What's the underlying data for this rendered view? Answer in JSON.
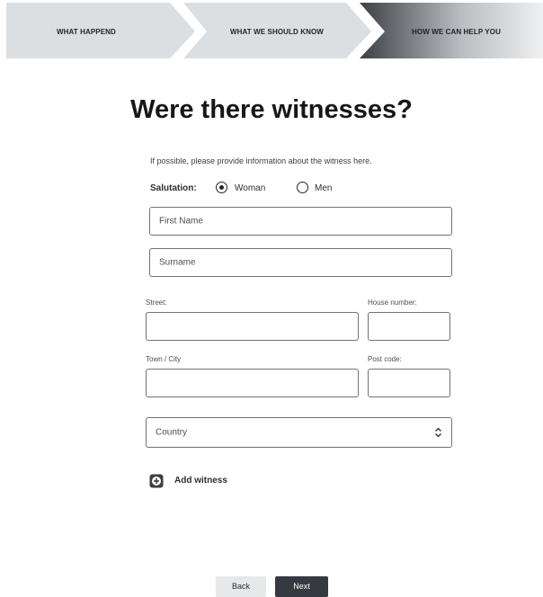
{
  "stepper": {
    "steps": [
      {
        "label": "WHAT HAPPEND"
      },
      {
        "label": "WHAT WE SHOULD KNOW"
      },
      {
        "label": "HOW WE CAN HELP YOU"
      }
    ],
    "active_index": 2,
    "colors": {
      "inactive": "#dcdfe1",
      "active_start": "#3b4045",
      "active_end": "#eef0f1"
    }
  },
  "page": {
    "title": "Were there witnesses?",
    "intro": "If possible, please provide information about the witness here."
  },
  "salutation": {
    "label": "Salutation:",
    "options": [
      {
        "label": "Woman",
        "selected": true
      },
      {
        "label": "Men",
        "selected": false
      }
    ]
  },
  "fields": {
    "first_name": {
      "placeholder": "First Name",
      "value": ""
    },
    "surname": {
      "placeholder": "Surname",
      "value": ""
    },
    "street": {
      "label": "Street:",
      "value": ""
    },
    "house_number": {
      "label": "House number:",
      "value": ""
    },
    "town": {
      "label": "Town / City",
      "value": ""
    },
    "post_code": {
      "label": "Post code:",
      "value": ""
    },
    "country": {
      "placeholder": "Country",
      "value": ""
    }
  },
  "actions": {
    "add_witness": "Add witness",
    "back": "Back",
    "next": "Next"
  },
  "icons": {
    "add": "plus-circle-icon",
    "select": "up-down-chevron-icon"
  }
}
